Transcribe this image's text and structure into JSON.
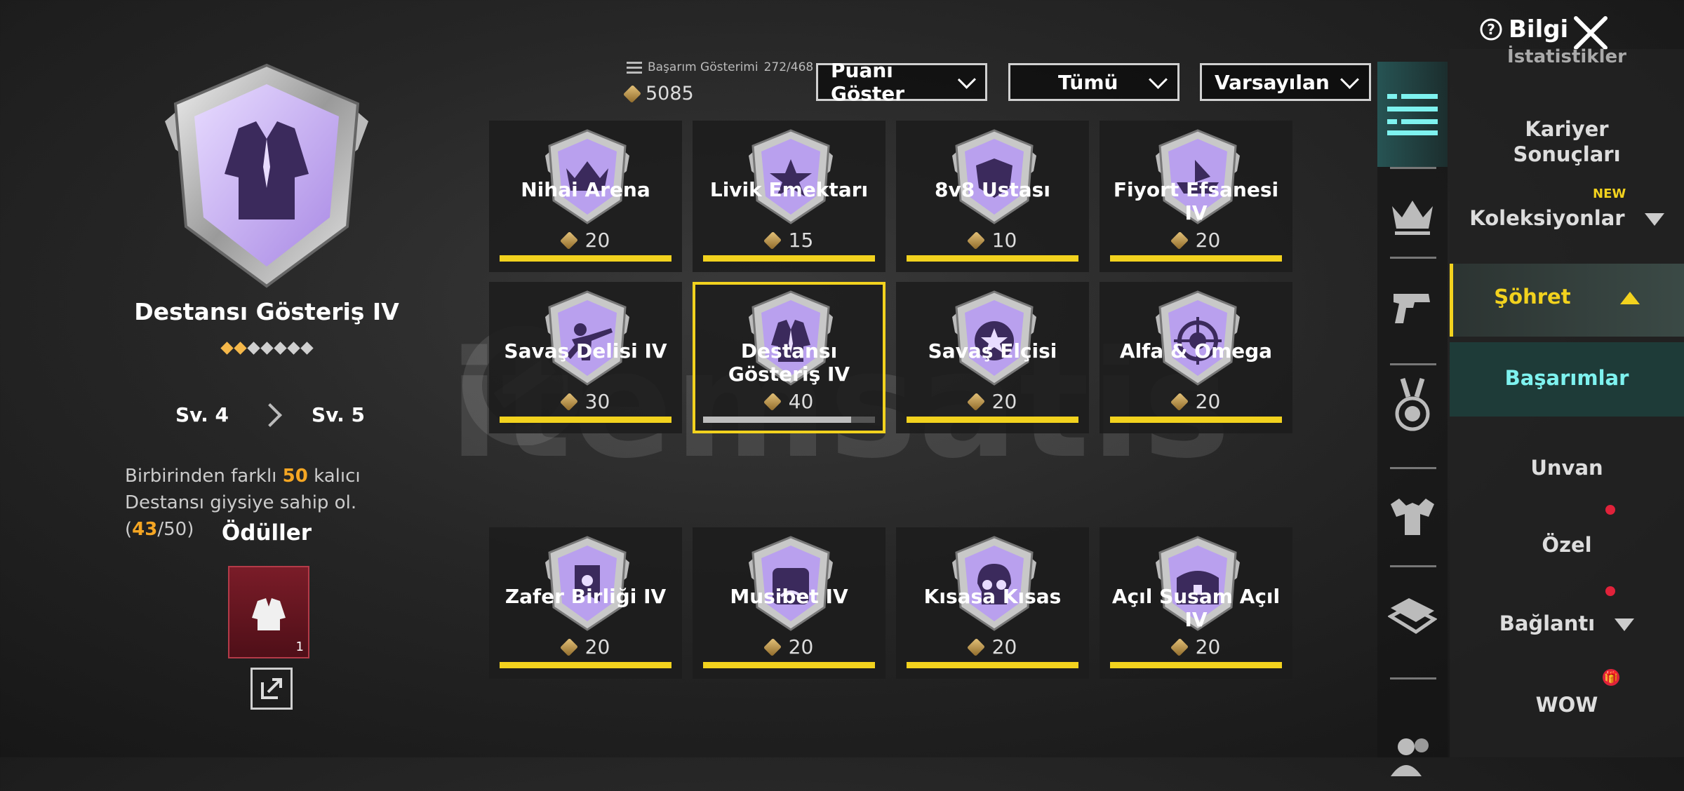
{
  "header": {
    "stat_label": "Başarım Gösterimi",
    "stat_value": "272/468",
    "points": "5085",
    "info_label": "Bilgi"
  },
  "filters": [
    {
      "label": "Puanı Göster"
    },
    {
      "label": "Tümü"
    },
    {
      "label": "Varsayılan"
    }
  ],
  "selected": {
    "title": "Destansı Gösteriş IV",
    "stars_filled": 2,
    "stars_total": 7,
    "level_from": "Sv. 4",
    "level_to": "Sv. 5",
    "desc_pre": "Birbirinden farklı ",
    "desc_num": "50",
    "desc_mid": " kalıcı Destansı giysiye sahip ol. (",
    "desc_progress": "43",
    "desc_total": "/50)",
    "rewards_title": "Ödüller",
    "reward_count": "1"
  },
  "achievements": [
    {
      "name": "Nihai Arena",
      "points": "20",
      "progress": 1.0,
      "icon": "crown-icon"
    },
    {
      "name": "Livik Emektarı",
      "points": "15",
      "progress": 1.0,
      "icon": "star-icon"
    },
    {
      "name": "8v8 Ustası",
      "points": "10",
      "progress": 1.0,
      "icon": "shield-icon"
    },
    {
      "name": "Fiyort Efsanesi IV",
      "points": "20",
      "progress": 1.0,
      "icon": "boat-icon"
    },
    {
      "name": "Savaş Delisi IV",
      "points": "30",
      "progress": 1.0,
      "icon": "soldier-icon"
    },
    {
      "name": "Destansı Gösteriş IV",
      "points": "40",
      "progress": 0.86,
      "icon": "jacket-icon",
      "selected": true
    },
    {
      "name": "Savaş Elçisi",
      "points": "20",
      "progress": 1.0,
      "icon": "star-badge-icon"
    },
    {
      "name": "Alfa & Omega",
      "points": "20",
      "progress": 1.0,
      "icon": "crosshair-icon"
    },
    {
      "name": "Zafer Birliği IV",
      "points": "20",
      "progress": 1.0,
      "icon": "banner-icon"
    },
    {
      "name": "Musibet IV",
      "points": "20",
      "progress": 1.0,
      "icon": "face-icon"
    },
    {
      "name": "Kısasa Kısas",
      "points": "20",
      "progress": 1.0,
      "icon": "skull-icon"
    },
    {
      "name": "Açıl Susam Açıl IV",
      "points": "20",
      "progress": 1.0,
      "icon": "chest-icon"
    }
  ],
  "menu": {
    "istatistikler": "İstatistikler",
    "kariyer_1": "Kariyer",
    "kariyer_2": "Sonuçları",
    "koleksiyonlar": "Koleksiyonlar",
    "new_tag": "NEW",
    "sohret": "Şöhret",
    "basarimlar": "Başarımlar",
    "unvan": "Unvan",
    "ozel": "Özel",
    "baglanti": "Bağlantı",
    "wow": "WOW"
  },
  "watermark": "itemsatis",
  "colors": {
    "accent_yellow": "#f2d21e",
    "accent_cyan": "#7ef2ef",
    "highlight_orange": "#f5a623",
    "badge_purple": "#8a58c8"
  }
}
